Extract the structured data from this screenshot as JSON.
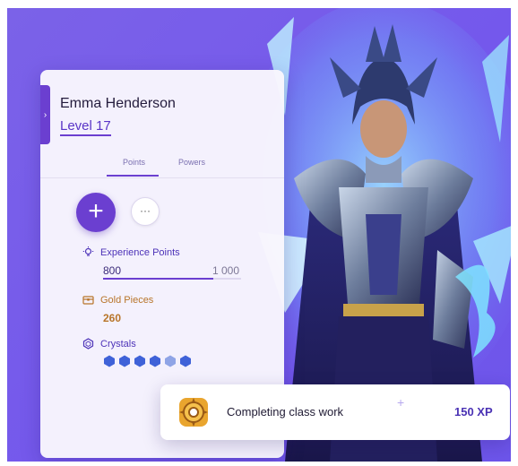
{
  "profile": {
    "name": "Emma Henderson",
    "level": "Level 17",
    "panel_toggle": "›"
  },
  "tabs": [
    "Points",
    "Powers"
  ],
  "actions": {
    "add": "+",
    "more": "···"
  },
  "stats": {
    "experience": {
      "label": "Experience Points",
      "value": "800",
      "max": "1 000",
      "progress": 0.8
    },
    "gold": {
      "label": "Gold Pieces",
      "value": "260"
    },
    "crystals": {
      "label": "Crystals",
      "count": 6,
      "partial_index": 4
    }
  },
  "notification": {
    "text": "Completing class work",
    "plus": "+",
    "xp": "150 XP"
  },
  "icons": {
    "experience": "lightbulb-icon",
    "gold": "treasure-chest-icon",
    "crystals": "crystal-icon",
    "badge": "gear-badge-icon"
  },
  "colors": {
    "background": "#7458ec",
    "accent": "#6b3fd0",
    "gold": "#b8752a",
    "crystal": "#3f62d8"
  }
}
